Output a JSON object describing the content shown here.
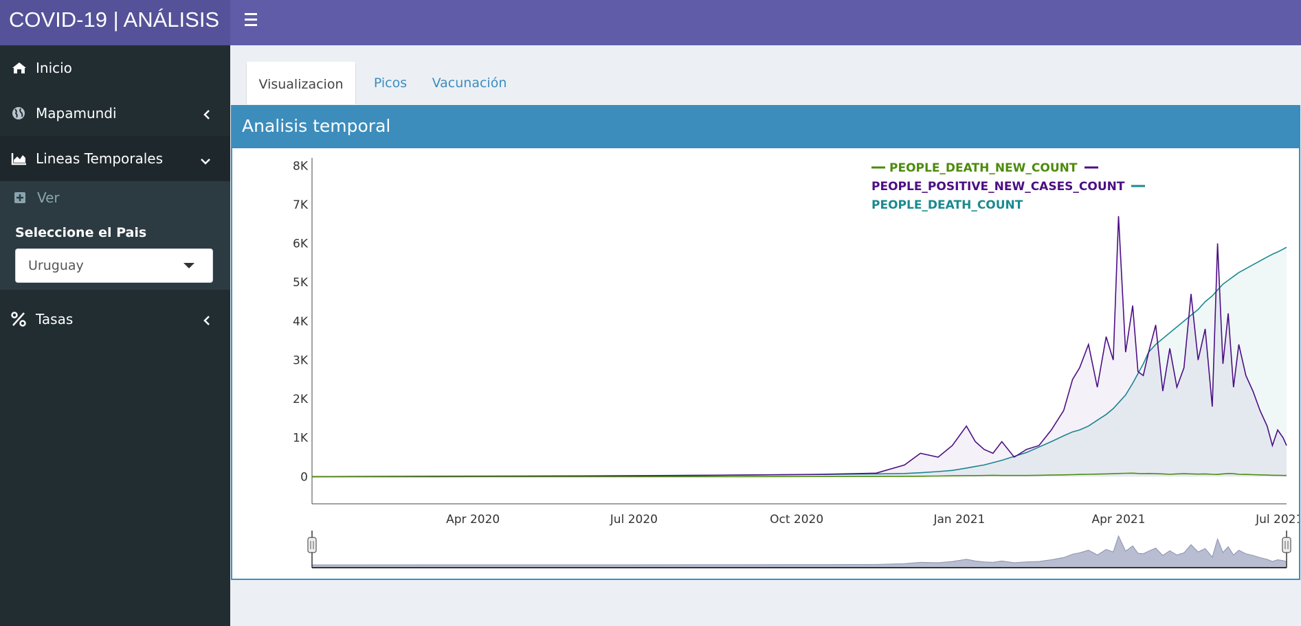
{
  "header": {
    "brand": "COVID-19 | ANÁLISIS"
  },
  "sidebar": {
    "items": [
      {
        "label": "Inicio",
        "icon": "home-icon"
      },
      {
        "label": "Mapamundi",
        "icon": "globe-icon"
      },
      {
        "label": "Lineas Temporales",
        "icon": "area-chart-icon"
      },
      {
        "label": "Tasas",
        "icon": "percent-icon"
      }
    ],
    "sub_item": "Ver",
    "country_label": "Seleccione el Pais",
    "country_value": "Uruguay"
  },
  "tabs": [
    "Visualizacion",
    "Picos",
    "Vacunación"
  ],
  "panel": {
    "title": "Analisis temporal"
  },
  "colors": {
    "header": "#605ca8",
    "sidebar": "#222d32",
    "box": "#3c8dbc",
    "death_new": "#4d8b0c",
    "positive_new": "#4b0e83",
    "death": "#1a8a8f"
  },
  "chart_data": {
    "type": "line",
    "xlabel": "",
    "ylabel": "",
    "ylim": [
      -700,
      8200
    ],
    "xlim": [
      "2020-01-01",
      "2021-07-05"
    ],
    "yticks": [
      0,
      1000,
      2000,
      3000,
      4000,
      5000,
      6000,
      7000,
      8000
    ],
    "yticklabels": [
      "0",
      "1K",
      "2K",
      "3K",
      "4K",
      "5K",
      "6K",
      "7K",
      "8K"
    ],
    "xticks": [
      "2020-04-01",
      "2020-07-01",
      "2020-10-01",
      "2021-01-01",
      "2021-04-01",
      "2021-07-01"
    ],
    "xticklabels": [
      "Apr 2020",
      "Jul 2020",
      "Oct 2020",
      "Jan 2021",
      "Apr 2021",
      "Jul 2021"
    ],
    "x": [
      "2020-01-01",
      "2020-03-13",
      "2020-05-01",
      "2020-07-01",
      "2020-09-01",
      "2020-10-15",
      "2020-11-15",
      "2020-12-01",
      "2020-12-10",
      "2020-12-20",
      "2020-12-28",
      "2021-01-05",
      "2021-01-10",
      "2021-01-15",
      "2021-01-20",
      "2021-01-25",
      "2021-02-01",
      "2021-02-08",
      "2021-02-15",
      "2021-02-22",
      "2021-03-01",
      "2021-03-06",
      "2021-03-10",
      "2021-03-15",
      "2021-03-20",
      "2021-03-25",
      "2021-03-29",
      "2021-04-01",
      "2021-04-05",
      "2021-04-09",
      "2021-04-12",
      "2021-04-15",
      "2021-04-18",
      "2021-04-22",
      "2021-04-26",
      "2021-04-30",
      "2021-05-04",
      "2021-05-08",
      "2021-05-12",
      "2021-05-16",
      "2021-05-20",
      "2021-05-24",
      "2021-05-27",
      "2021-05-30",
      "2021-06-02",
      "2021-06-05",
      "2021-06-08",
      "2021-06-12",
      "2021-06-16",
      "2021-06-20",
      "2021-06-24",
      "2021-06-27",
      "2021-06-30",
      "2021-07-03",
      "2021-07-05"
    ],
    "series": [
      {
        "name": "PEOPLE_DEATH_NEW_COUNT",
        "color": "#4d8b0c",
        "values": [
          0,
          0,
          0,
          0,
          0,
          2,
          5,
          8,
          10,
          15,
          20,
          25,
          25,
          30,
          35,
          30,
          30,
          30,
          35,
          40,
          45,
          50,
          55,
          60,
          65,
          70,
          75,
          80,
          85,
          90,
          80,
          75,
          80,
          75,
          70,
          60,
          70,
          75,
          70,
          65,
          70,
          60,
          55,
          70,
          80,
          75,
          60,
          55,
          50,
          45,
          40,
          35,
          35,
          30,
          30
        ]
      },
      {
        "name": "PEOPLE_POSITIVE_NEW_CASES_COUNT",
        "color": "#4b0e83",
        "values": [
          0,
          10,
          15,
          20,
          40,
          60,
          90,
          300,
          600,
          500,
          800,
          1300,
          900,
          700,
          600,
          900,
          500,
          700,
          800,
          1200,
          1700,
          2500,
          2800,
          3400,
          2300,
          3600,
          3000,
          6700,
          3200,
          4400,
          2700,
          2600,
          3200,
          3900,
          2200,
          3300,
          2300,
          2800,
          4700,
          3000,
          3800,
          1800,
          6000,
          2900,
          4200,
          2300,
          3400,
          2600,
          2200,
          1700,
          1300,
          800,
          1200,
          1000,
          800
        ]
      },
      {
        "name": "PEOPLE_DEATH_COUNT",
        "color": "#1a8a8f",
        "values": [
          0,
          0,
          10,
          25,
          40,
          55,
          70,
          80,
          100,
          130,
          160,
          220,
          260,
          300,
          360,
          420,
          520,
          620,
          760,
          900,
          1050,
          1150,
          1200,
          1300,
          1450,
          1600,
          1750,
          1900,
          2100,
          2400,
          2650,
          2900,
          3200,
          3400,
          3550,
          3700,
          3850,
          4000,
          4150,
          4300,
          4500,
          4650,
          4800,
          4950,
          5050,
          5150,
          5250,
          5350,
          5450,
          5550,
          5650,
          5720,
          5780,
          5850,
          5900
        ]
      }
    ],
    "legend": "top-right"
  }
}
